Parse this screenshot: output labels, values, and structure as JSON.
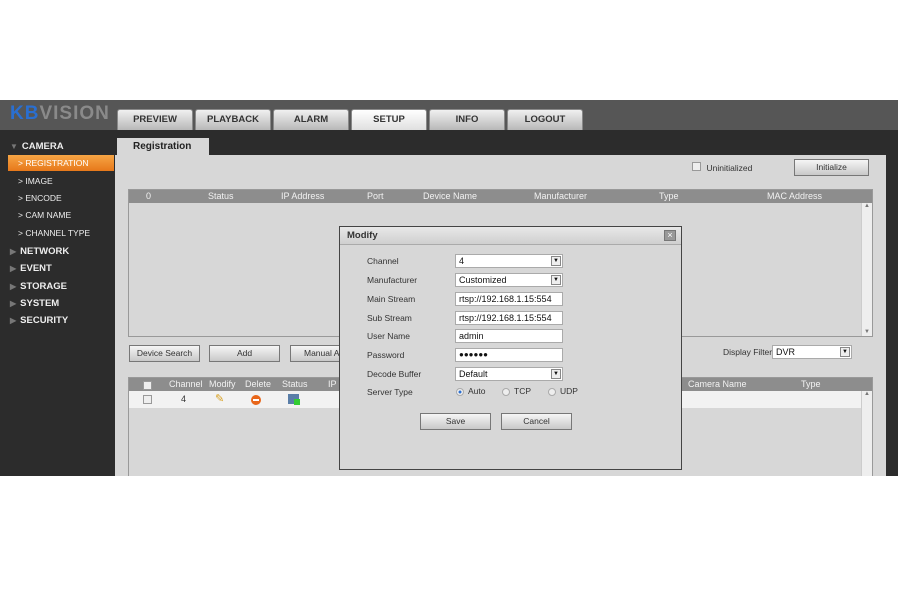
{
  "brand": {
    "logo_a": "KB",
    "logo_b": "VISION"
  },
  "nav_tabs": [
    {
      "label": "PREVIEW"
    },
    {
      "label": "PLAYBACK"
    },
    {
      "label": "ALARM"
    },
    {
      "label": "SETUP",
      "active": true
    },
    {
      "label": "INFO"
    },
    {
      "label": "LOGOUT"
    }
  ],
  "sidebar": {
    "camera": "CAMERA",
    "camera_items": [
      {
        "label": "REGISTRATION",
        "selected": true
      },
      {
        "label": "IMAGE"
      },
      {
        "label": "ENCODE"
      },
      {
        "label": "CAM NAME"
      },
      {
        "label": "CHANNEL TYPE"
      }
    ],
    "sections": [
      "NETWORK",
      "EVENT",
      "STORAGE",
      "SYSTEM",
      "SECURITY"
    ]
  },
  "page_tab": "Registration",
  "uninitialized_label": "Uninitialized",
  "initialize_button": "Initialize",
  "search_grid": {
    "columns": [
      "0",
      "Status",
      "IP Address",
      "Port",
      "Device Name",
      "Manufacturer",
      "Type",
      "MAC Address"
    ]
  },
  "buttons": {
    "device_search": "Device Search",
    "add": "Add",
    "manual_add": "Manual A"
  },
  "display_filter": {
    "label": "Display Filter",
    "value": "DVR"
  },
  "added_grid": {
    "columns": [
      "Channel",
      "Modify",
      "Delete",
      "Status",
      "IP",
      "Camera Name",
      "Type"
    ],
    "rows": [
      {
        "channel": "4"
      }
    ]
  },
  "modal": {
    "title": "Modify",
    "fields": {
      "channel": {
        "label": "Channel",
        "value": "4"
      },
      "manufacturer": {
        "label": "Manufacturer",
        "value": "Customized"
      },
      "main_stream": {
        "label": "Main Stream",
        "value": "rtsp://192.168.1.15:554"
      },
      "sub_stream": {
        "label": "Sub Stream",
        "value": "rtsp://192.168.1.15:554"
      },
      "user_name": {
        "label": "User Name",
        "value": "admin"
      },
      "password": {
        "label": "Password",
        "value": "●●●●●●"
      },
      "decode_buffer": {
        "label": "Decode Buffer",
        "value": "Default"
      },
      "server_type": {
        "label": "Server Type",
        "options": [
          "Auto",
          "TCP",
          "UDP"
        ],
        "selected": "Auto"
      }
    },
    "save": "Save",
    "cancel": "Cancel"
  }
}
